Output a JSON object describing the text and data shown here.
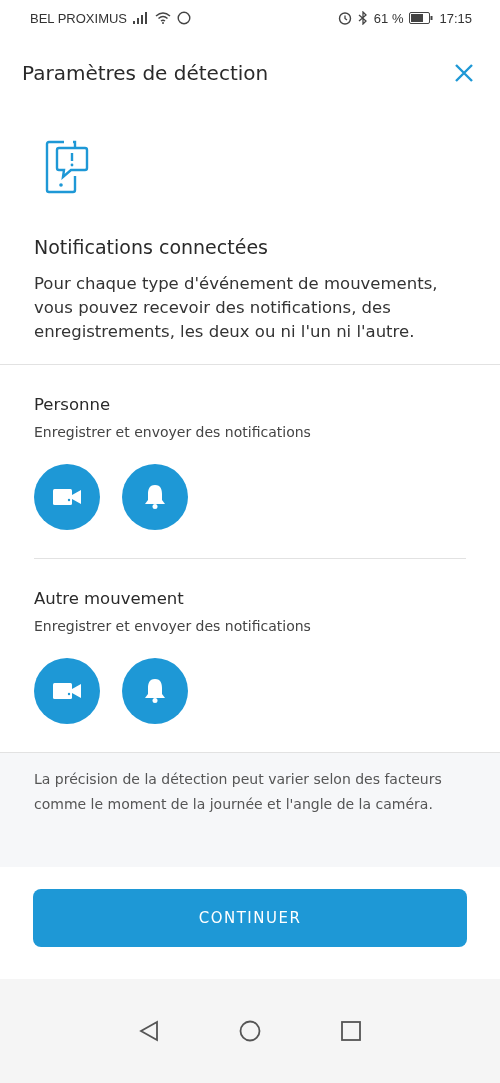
{
  "status_bar": {
    "carrier": "BEL PROXIMUS",
    "battery": "61 %",
    "time": "17:15"
  },
  "header": {
    "title": "Paramètres de détection"
  },
  "intro": {
    "title": "Notifications connectées",
    "text": "Pour chaque type d'événement de mouvements, vous pouvez recevoir des notifications, des enregistrements, les deux ou ni l'un ni l'autre."
  },
  "sections": [
    {
      "title": "Personne",
      "subtitle": "Enregistrer et envoyer des notifications",
      "record_on": true,
      "notify_on": true
    },
    {
      "title": "Autre mouvement",
      "subtitle": "Enregistrer et envoyer des notifications",
      "record_on": true,
      "notify_on": true
    }
  ],
  "footnote": "La précision de la détection peut varier selon des facteurs comme le moment de la journée et l'angle de la caméra.",
  "continue_button": "CONTINUER"
}
